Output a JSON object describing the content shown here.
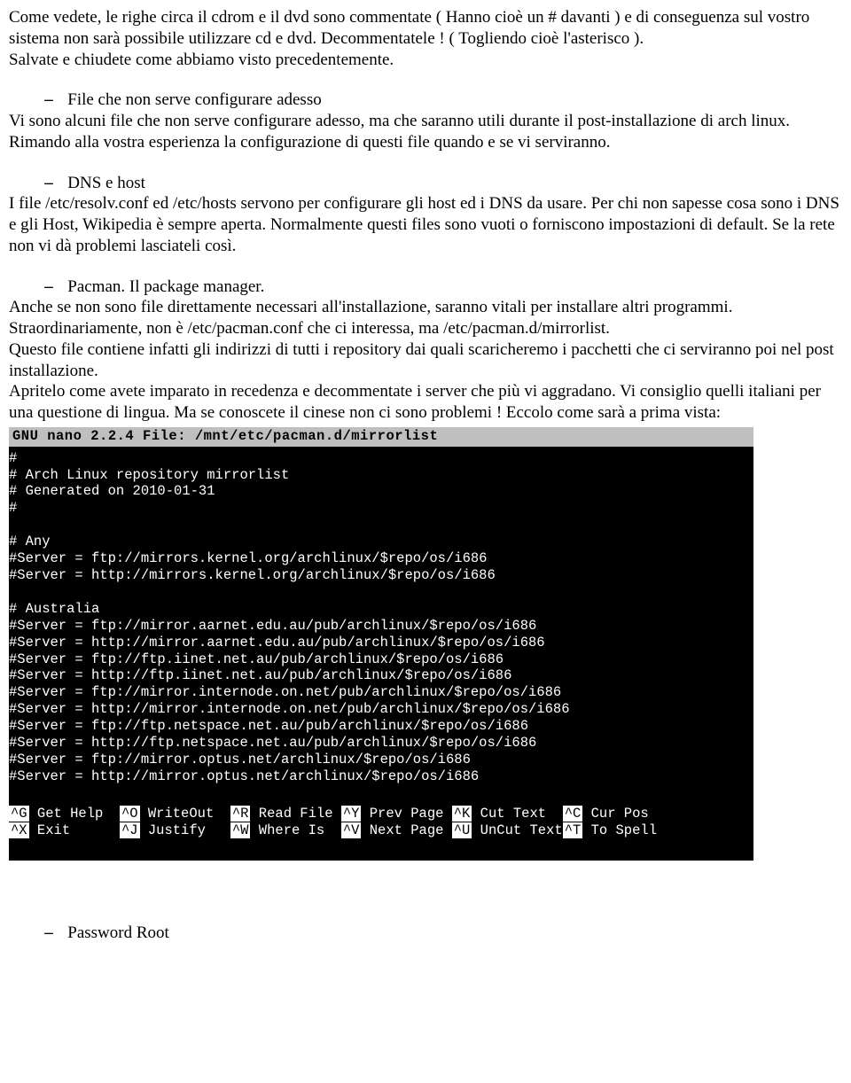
{
  "intro": "Come vedete, le righe circa il cdrom e il dvd sono commentate ( Hanno cioè un # davanti ) e di conseguenza sul vostro sistema non sarà  possibile utilizzare cd e dvd. Decommentatele ! ( Togliendo cioè l'asterisco ).\nSalvate e chiudete come abbiamo visto precedentemente.",
  "sec1": {
    "title": "File che non serve configurare adesso",
    "body": "Vi sono alcuni file che non serve configurare adesso, ma che saranno utili durante il post-installazione di arch linux. Rimando alla vostra esperienza la configurazione di questi file quando e se vi serviranno."
  },
  "sec2": {
    "title": "DNS e host",
    "body": "I file /etc/resolv.conf ed /etc/hosts servono per configurare gli host ed i DNS da usare. Per chi non sapesse cosa sono i DNS e gli Host, Wikipedia è sempre aperta. Normalmente questi files sono vuoti o forniscono impostazioni di default. Se la rete non vi dà problemi lasciateli così."
  },
  "sec3": {
    "title": "Pacman. Il package manager.",
    "body": "Anche se non sono file direttamente necessari all'installazione, saranno vitali per installare altri programmi.\nStraordinariamente, non è /etc/pacman.conf che ci interessa, ma /etc/pacman.d/mirrorlist.\nQuesto file contiene infatti gli indirizzi di tutti i repository dai quali scaricheremo i pacchetti che ci serviranno poi nel post installazione.\nApritelo come avete imparato in recedenza e decommentate i server che più vi aggradano. Vi consiglio quelli italiani per una questione di lingua. Ma se conoscete il cinese non ci sono problemi ! Eccolo come sarà a prima vista:"
  },
  "terminal": {
    "header": "  GNU nano 2.2.4        File: /mnt/etc/pacman.d/mirrorlist",
    "lines": [
      "#",
      "# Arch Linux repository mirrorlist",
      "# Generated on 2010-01-31",
      "#",
      "",
      "# Any",
      "#Server = ftp://mirrors.kernel.org/archlinux/$repo/os/i686",
      "#Server = http://mirrors.kernel.org/archlinux/$repo/os/i686",
      "",
      "# Australia",
      "#Server = ftp://mirror.aarnet.edu.au/pub/archlinux/$repo/os/i686",
      "#Server = http://mirror.aarnet.edu.au/pub/archlinux/$repo/os/i686",
      "#Server = ftp://ftp.iinet.net.au/pub/archlinux/$repo/os/i686",
      "#Server = http://ftp.iinet.net.au/pub/archlinux/$repo/os/i686",
      "#Server = ftp://mirror.internode.on.net/pub/archlinux/$repo/os/i686",
      "#Server = http://mirror.internode.on.net/pub/archlinux/$repo/os/i686",
      "#Server = ftp://ftp.netspace.net.au/pub/archlinux/$repo/os/i686",
      "#Server = http://ftp.netspace.net.au/pub/archlinux/$repo/os/i686",
      "#Server = ftp://mirror.optus.net/archlinux/$repo/os/i686",
      "#Server = http://mirror.optus.net/archlinux/$repo/os/i686"
    ],
    "footer": {
      "g": "^G",
      "gL": " Get Help  ",
      "o": "^O",
      "oL": " WriteOut  ",
      "r": "^R",
      "rL": " Read File ",
      "y": "^Y",
      "yL": " Prev Page ",
      "k": "^K",
      "kL": " Cut Text  ",
      "c": "^C",
      "cL": " Cur Pos",
      "x": "^X",
      "xL": " Exit      ",
      "j": "^J",
      "jL": " Justify   ",
      "w": "^W",
      "wL": " Where Is  ",
      "v": "^V",
      "vL": " Next Page ",
      "u": "^U",
      "uL": " UnCut Text",
      "t": "^T",
      "tL": " To Spell"
    }
  },
  "sec4": {
    "title": "Password Root"
  },
  "dash": "–"
}
